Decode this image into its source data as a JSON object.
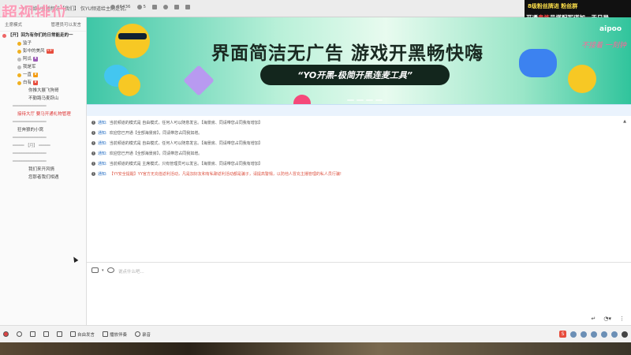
{
  "topbar": {
    "channel_name": "YY U媒U直播频道【我们】 仅YU频道给主的是说。",
    "stats": [
      {
        "icon": "people-icon",
        "value": "66436"
      },
      {
        "icon": "person-icon",
        "value": "5"
      }
    ]
  },
  "overlay": {
    "watermark_left": "超视排位",
    "line1": "8级粉丝牌进  粉丝群",
    "line2_prefix": "开通",
    "line2_highlight": "贵族",
    "line2_suffix": "号搭配军谋加一天日导"
  },
  "sidebar": {
    "tab_left": "主席模式",
    "tab_right": "管理员可以发言",
    "room_title": "【开】回为有你们的日常能走的一",
    "items": [
      {
        "text": "监子",
        "kind": "sub",
        "dot": "yellow"
      },
      {
        "text": "彭中的美风",
        "kind": "sub",
        "dot": "yellow"
      },
      {
        "text": "阿瓜",
        "kind": "sub",
        "dot": "gray"
      },
      {
        "text": "我是军",
        "kind": "sub",
        "dot": "gray"
      },
      {
        "text": "一直",
        "kind": "sub",
        "dot": "yellow"
      },
      {
        "text": "白有",
        "kind": "sub",
        "dot": "yellow"
      },
      {
        "text": "你推大展飞狗哥",
        "kind": "sub2"
      },
      {
        "text": "不勤路马麦跃山",
        "kind": "sub2"
      },
      {
        "text": "",
        "kind": "dash"
      },
      {
        "text": "接待大厅 要马开通礼物管理",
        "kind": "red"
      },
      {
        "text": "",
        "kind": "dash"
      },
      {
        "text": "狂奔狼的小窝",
        "kind": "sub"
      },
      {
        "text": "",
        "kind": "dash"
      },
      {
        "text": "【月】",
        "kind": "dash"
      },
      {
        "text": "",
        "kind": "dash"
      },
      {
        "text": "",
        "kind": "dash"
      },
      {
        "text": "我们来开风情",
        "kind": "sub2"
      },
      {
        "text": "您那者我们相遇",
        "kind": "sub2"
      }
    ]
  },
  "banner": {
    "title": "界面简洁无广告  游戏开黑畅快嗨",
    "pill": "“YO开黑-极简开黑连麦工具”",
    "sticker": "aipoo",
    "sticker2": "不接着 一刻钟"
  },
  "chat": {
    "messages": [
      {
        "label": "通知:",
        "text": "当前频道的模式是 自由模式，任何人可以随意发言。【海景房、同请带您占同我有增加】",
        "color": "blue"
      },
      {
        "label": "通知:",
        "text": "欢迎您已开通【全部海景房】，同请带您占同我如增。",
        "color": "blue"
      },
      {
        "label": "通知:",
        "text": "当前频道的模式是 自由模式，任何人可以随意发言。【海景房、同请带您占同我有增加】",
        "color": "blue"
      },
      {
        "label": "通知:",
        "text": "欢迎您已开通【全部海景房】，同请带您占同我如增。",
        "color": "blue"
      },
      {
        "label": "通知:",
        "text": "当前频道的模式是 主席模式，只有管理员可以发言。【海景房、同请带您占同我有增加】",
        "color": "blue"
      },
      {
        "label": "通知:",
        "text": "【YY安全提醒】YY官方无充值返利活动，凡是加好友和有私聊返利活动都是骗子，请提高警惕，以防他人冒充主播管理的私人员行骗!",
        "color": "blue"
      }
    ]
  },
  "composer": {
    "placeholder": "说点什么吧..."
  },
  "bottombar": {
    "items": [
      {
        "icon": "mic-icon",
        "label": "自由发言"
      },
      {
        "icon": "music-icon",
        "label": "播放伴奏"
      },
      {
        "icon": "record-icon",
        "label": "录音"
      }
    ]
  }
}
